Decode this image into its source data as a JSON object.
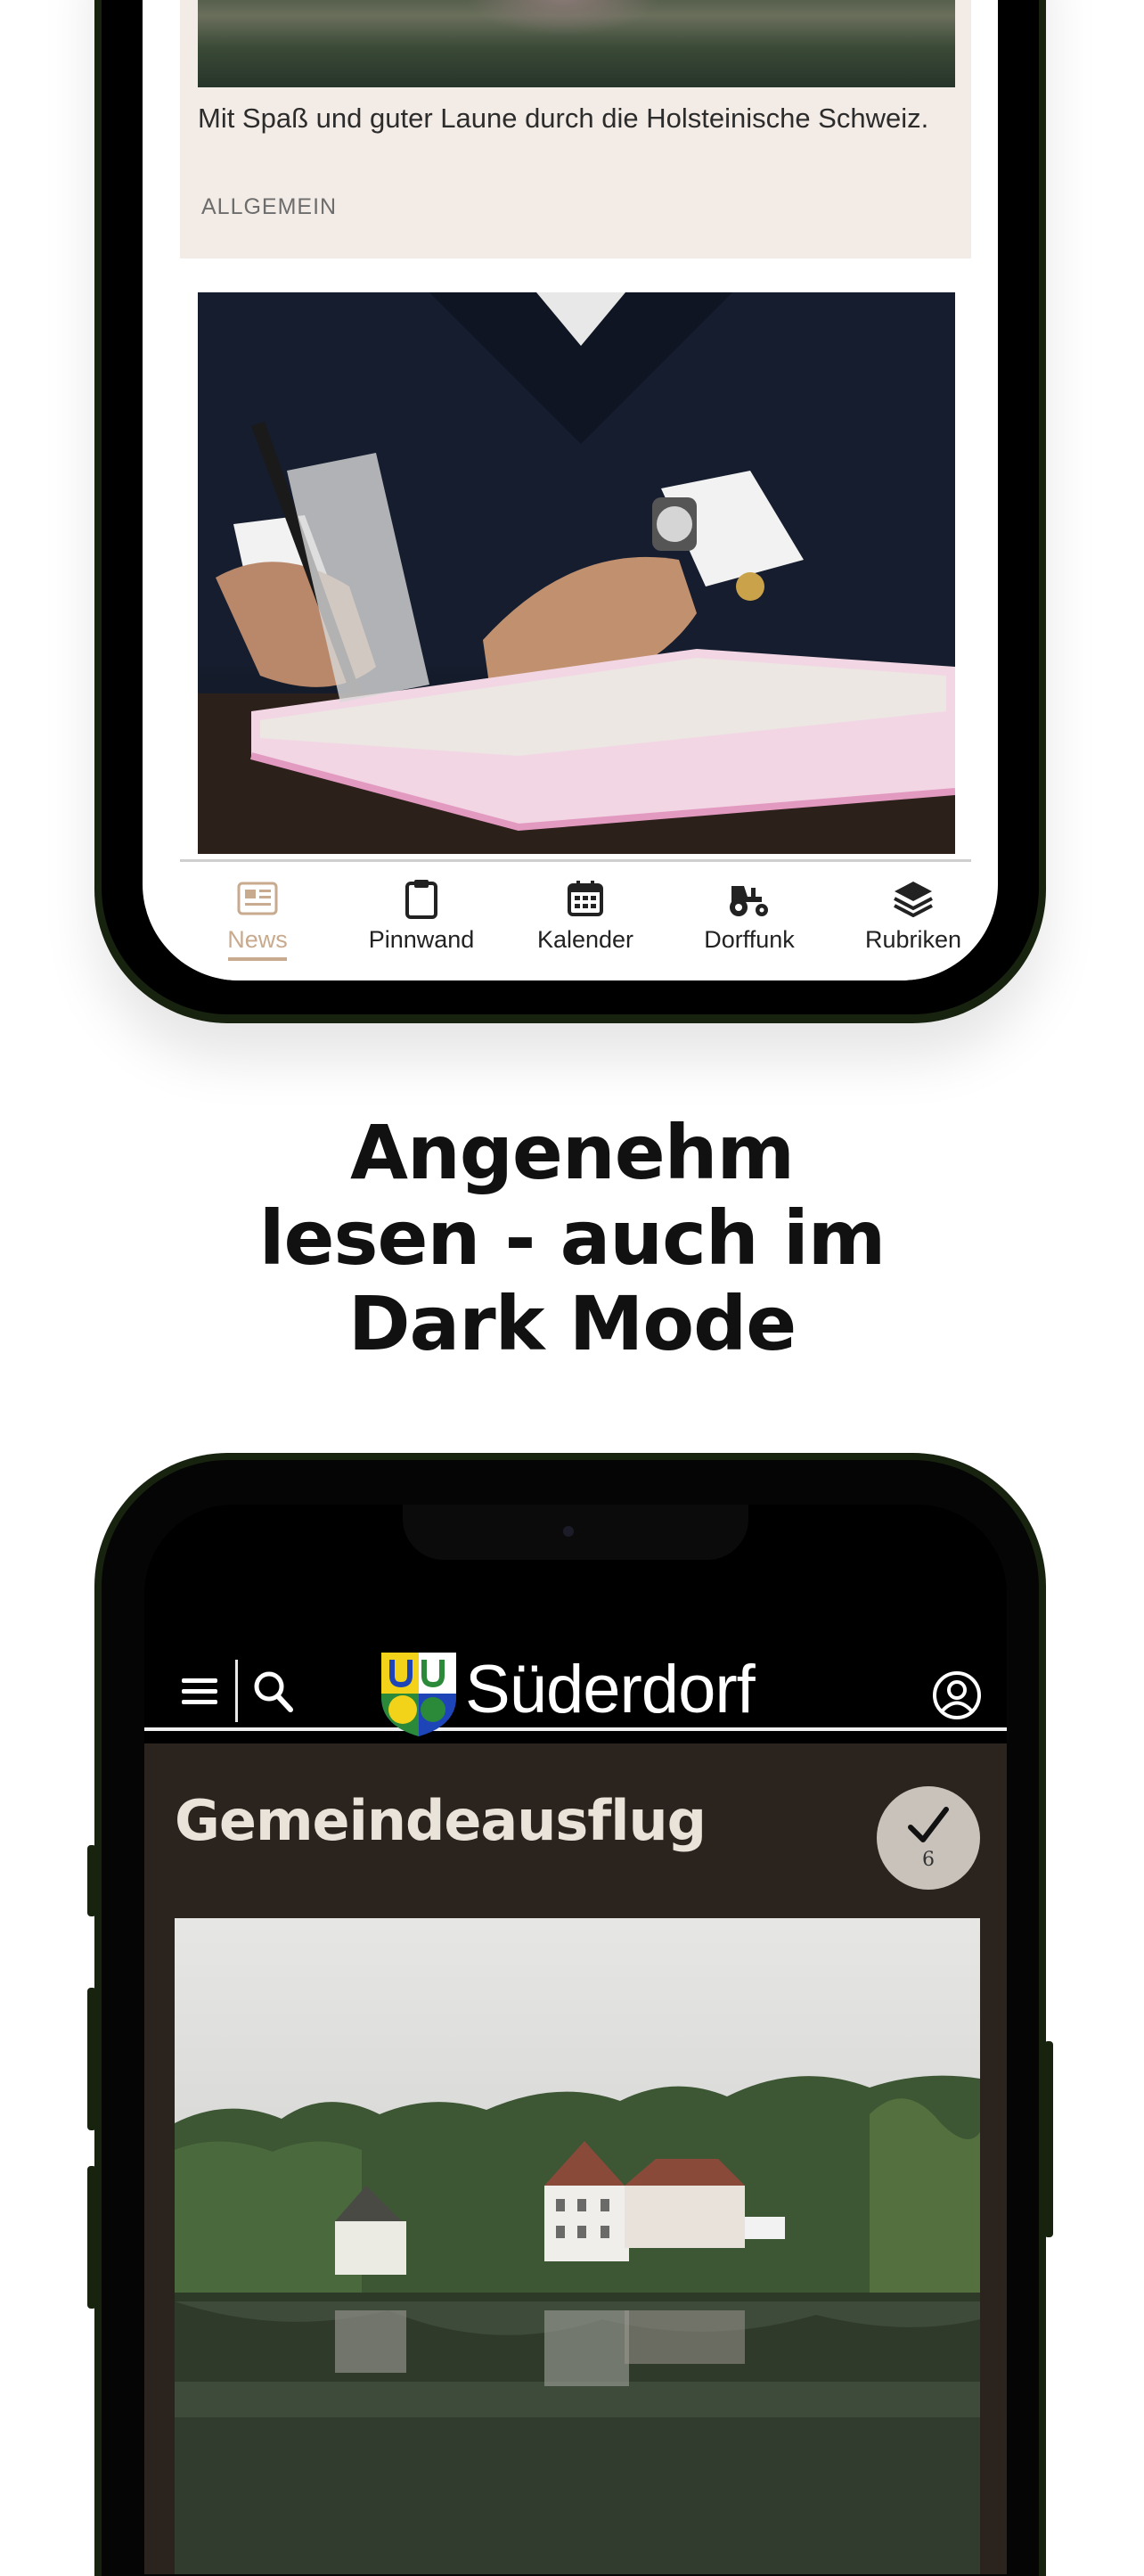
{
  "phone_light": {
    "card_teaser": "Mit Spaß und guter Laune durch die Holsteinische Schweiz.",
    "card_category": "ALLGEMEIN",
    "tabs": [
      {
        "label": "News",
        "icon": "newspaper-icon",
        "active": true
      },
      {
        "label": "Pinnwand",
        "icon": "clipboard-icon",
        "active": false
      },
      {
        "label": "Kalender",
        "icon": "calendar-icon",
        "active": false
      },
      {
        "label": "Dorffunk",
        "icon": "tractor-icon",
        "active": false
      },
      {
        "label": "Rubriken",
        "icon": "layers-icon",
        "active": false
      }
    ],
    "active_color": "#c8aa8f"
  },
  "headline": {
    "line1": "Angenehm",
    "line2": "lesen - auch im",
    "line3": "Dark Mode"
  },
  "phone_dark": {
    "brand": "Süderdorf",
    "article_title": "Gemeindeausflug",
    "check_count": "6",
    "card_bg": "#2a231e"
  }
}
